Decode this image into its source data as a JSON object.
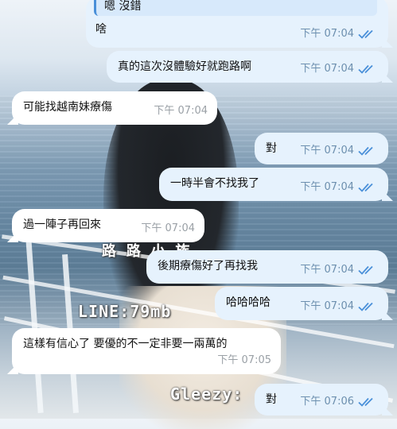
{
  "watermarks": {
    "line": "LINE:79mb",
    "gleezy": "Gleezy:",
    "lulu": "路 路 小 族"
  },
  "messages": [
    {
      "id": "m1",
      "direction": "out",
      "quote": "嗯 沒錯",
      "text": "啥",
      "time": "下午 07:04",
      "status": "read"
    },
    {
      "id": "m2",
      "direction": "out",
      "text": "真的這次沒體驗好就跑路啊",
      "time": "下午 07:04",
      "status": "read"
    },
    {
      "id": "m3",
      "direction": "in",
      "text": "可能找越南妹療傷",
      "time": "下午 07:04"
    },
    {
      "id": "m4",
      "direction": "out",
      "text": "對",
      "time": "下午 07:04",
      "status": "read"
    },
    {
      "id": "m5",
      "direction": "out",
      "text": "一時半會不找我了",
      "time": "下午 07:04",
      "status": "read"
    },
    {
      "id": "m6",
      "direction": "in",
      "text": "過一陣子再回來",
      "time": "下午 07:04"
    },
    {
      "id": "m7",
      "direction": "out",
      "text": "後期療傷好了再找我",
      "time": "下午 07:04",
      "status": "read"
    },
    {
      "id": "m8",
      "direction": "out",
      "text": "哈哈哈哈",
      "time": "下午 07:04",
      "status": "read"
    },
    {
      "id": "m9",
      "direction": "in",
      "text": "這樣有信心了 要優的不一定非要一兩萬的",
      "time": "下午 07:05"
    },
    {
      "id": "m10",
      "direction": "out",
      "text": "對",
      "time": "下午 07:06",
      "status": "read"
    }
  ],
  "colors": {
    "out_bubble": "#e6f2fd",
    "in_bubble": "#ffffff",
    "check": "#4a90d9",
    "quote_bar": "#4a90d9"
  }
}
